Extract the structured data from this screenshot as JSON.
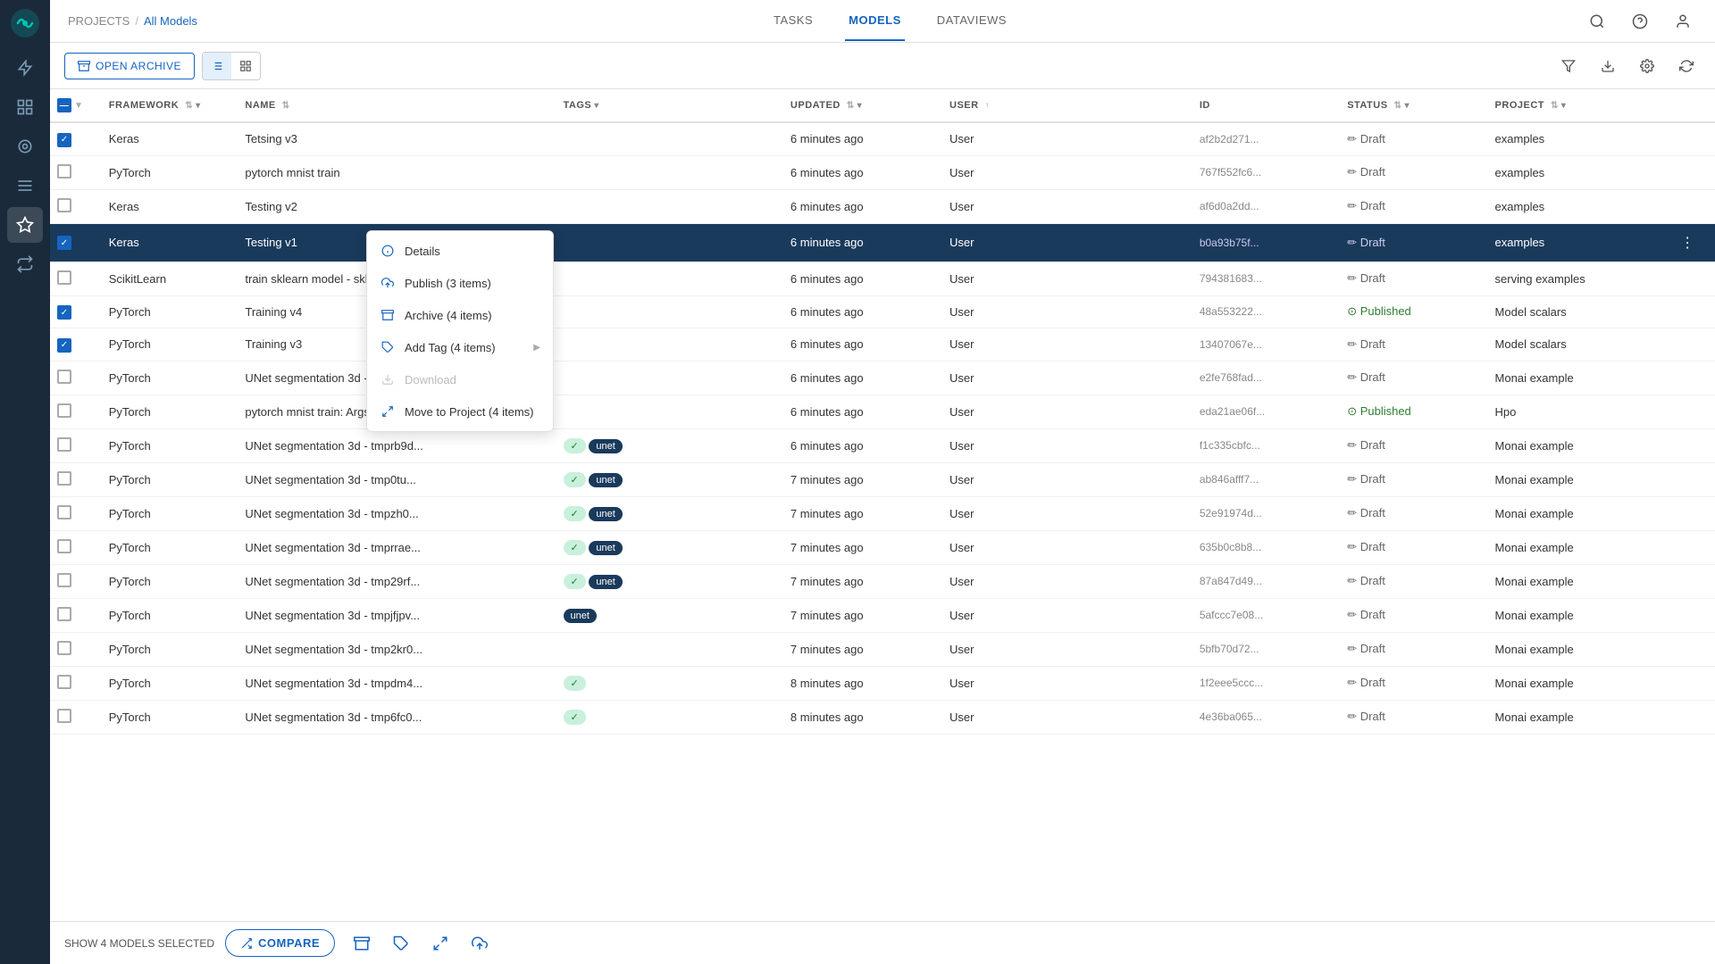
{
  "app": {
    "title": "ClearML"
  },
  "breadcrumb": {
    "parent": "PROJECTS",
    "separator": "/",
    "current": "All Models"
  },
  "nav": {
    "tabs": [
      {
        "id": "tasks",
        "label": "TASKS",
        "active": false
      },
      {
        "id": "models",
        "label": "MODELS",
        "active": true
      },
      {
        "id": "dataviews",
        "label": "DATAVIEWS",
        "active": false
      }
    ]
  },
  "toolbar": {
    "open_archive_label": "OPEN ARCHIVE"
  },
  "table": {
    "columns": [
      {
        "id": "check",
        "label": ""
      },
      {
        "id": "framework",
        "label": "FRAMEWORK"
      },
      {
        "id": "name",
        "label": "NAME"
      },
      {
        "id": "tags",
        "label": "TAGS"
      },
      {
        "id": "updated",
        "label": "UPDATED"
      },
      {
        "id": "user",
        "label": "USER"
      },
      {
        "id": "id",
        "label": "ID"
      },
      {
        "id": "status",
        "label": "STATUS"
      },
      {
        "id": "project",
        "label": "PROJECT"
      }
    ],
    "rows": [
      {
        "checked": true,
        "framework": "Keras",
        "name": "Tetsing v3",
        "tags": [],
        "updated": "6 minutes ago",
        "user": "User",
        "id": "af2b2d271...",
        "status": "Draft",
        "status_type": "draft",
        "project": "examples",
        "selected": false
      },
      {
        "checked": false,
        "framework": "PyTorch",
        "name": "pytorch mnist train",
        "tags": [],
        "updated": "6 minutes ago",
        "user": "User",
        "id": "767f552fc6...",
        "status": "Draft",
        "status_type": "draft",
        "project": "examples",
        "selected": false
      },
      {
        "checked": false,
        "framework": "Keras",
        "name": "Testing v2",
        "tags": [],
        "updated": "6 minutes ago",
        "user": "User",
        "id": "af6d0a2dd...",
        "status": "Draft",
        "status_type": "draft",
        "project": "examples",
        "selected": false
      },
      {
        "checked": true,
        "framework": "Keras",
        "name": "Testing v1",
        "tags": [],
        "updated": "6 minutes ago",
        "user": "User",
        "id": "b0a93b75f...",
        "status": "Draft",
        "status_type": "draft",
        "project": "examples",
        "selected": true
      },
      {
        "checked": false,
        "framework": "ScikitLearn",
        "name": "train sklearn model - sklearn-mo...",
        "tags": [],
        "updated": "6 minutes ago",
        "user": "User",
        "id": "794381683...",
        "status": "Draft",
        "status_type": "draft",
        "project": "serving examples",
        "selected": false
      },
      {
        "checked": true,
        "framework": "PyTorch",
        "name": "Training v4",
        "tags": [],
        "updated": "6 minutes ago",
        "user": "User",
        "id": "48a553222...",
        "status": "Published",
        "status_type": "published",
        "project": "Model scalars",
        "selected": false
      },
      {
        "checked": true,
        "framework": "PyTorch",
        "name": "Training v3",
        "tags": [],
        "updated": "6 minutes ago",
        "user": "User",
        "id": "13407067e...",
        "status": "Draft",
        "status_type": "draft",
        "project": "Model scalars",
        "selected": false
      },
      {
        "checked": false,
        "framework": "PyTorch",
        "name": "UNet segmentation 3d - tmpvjhyl...",
        "tags": [],
        "updated": "6 minutes ago",
        "user": "User",
        "id": "e2fe768fad...",
        "status": "Draft",
        "status_type": "draft",
        "project": "Monai example",
        "selected": false
      },
      {
        "checked": false,
        "framework": "PyTorch",
        "name": "pytorch mnist train: Args/lr=0.01",
        "tags": [],
        "updated": "6 minutes ago",
        "user": "User",
        "id": "eda21ae06f...",
        "status": "Published",
        "status_type": "published",
        "project": "Hpo",
        "selected": false
      },
      {
        "checked": false,
        "framework": "PyTorch",
        "name": "UNet segmentation 3d - tmprb9d...",
        "tags": [
          "✓",
          "unet"
        ],
        "updated": "6 minutes ago",
        "user": "User",
        "id": "f1c335cbfc...",
        "status": "Draft",
        "status_type": "draft",
        "project": "Monai example",
        "selected": false
      },
      {
        "checked": false,
        "framework": "PyTorch",
        "name": "UNet segmentation 3d - tmp0tu...",
        "tags": [
          "✓",
          "unet"
        ],
        "updated": "7 minutes ago",
        "user": "User",
        "id": "ab846afff7...",
        "status": "Draft",
        "status_type": "draft",
        "project": "Monai example",
        "selected": false
      },
      {
        "checked": false,
        "framework": "PyTorch",
        "name": "UNet segmentation 3d - tmpzh0...",
        "tags": [
          "✓",
          "unet"
        ],
        "updated": "7 minutes ago",
        "user": "User",
        "id": "52e91974d...",
        "status": "Draft",
        "status_type": "draft",
        "project": "Monai example",
        "selected": false
      },
      {
        "checked": false,
        "framework": "PyTorch",
        "name": "UNet segmentation 3d - tmprrae...",
        "tags": [
          "✓",
          "unet"
        ],
        "updated": "7 minutes ago",
        "user": "User",
        "id": "635b0c8b8...",
        "status": "Draft",
        "status_type": "draft",
        "project": "Monai example",
        "selected": false
      },
      {
        "checked": false,
        "framework": "PyTorch",
        "name": "UNet segmentation 3d - tmp29rf...",
        "tags": [
          "✓",
          "unet"
        ],
        "updated": "7 minutes ago",
        "user": "User",
        "id": "87a847d49...",
        "status": "Draft",
        "status_type": "draft",
        "project": "Monai example",
        "selected": false
      },
      {
        "checked": false,
        "framework": "PyTorch",
        "name": "UNet segmentation 3d - tmpjfjpv...",
        "tags": [
          "unet"
        ],
        "updated": "7 minutes ago",
        "user": "User",
        "id": "5afccc7e08...",
        "status": "Draft",
        "status_type": "draft",
        "project": "Monai example",
        "selected": false
      },
      {
        "checked": false,
        "framework": "PyTorch",
        "name": "UNet segmentation 3d - tmp2kr0...",
        "tags": [],
        "updated": "7 minutes ago",
        "user": "User",
        "id": "5bfb70d72...",
        "status": "Draft",
        "status_type": "draft",
        "project": "Monai example",
        "selected": false
      },
      {
        "checked": false,
        "framework": "PyTorch",
        "name": "UNet segmentation 3d - tmpdm4...",
        "tags": [
          "✓"
        ],
        "updated": "8 minutes ago",
        "user": "User",
        "id": "1f2eee5ccc...",
        "status": "Draft",
        "status_type": "draft",
        "project": "Monai example",
        "selected": false
      },
      {
        "checked": false,
        "framework": "PyTorch",
        "name": "UNet segmentation 3d - tmp6fc0...",
        "tags": [
          "✓"
        ],
        "updated": "8 minutes ago",
        "user": "User",
        "id": "4e36ba065...",
        "status": "Draft",
        "status_type": "draft",
        "project": "Monai example",
        "selected": false
      }
    ]
  },
  "context_menu": {
    "items": [
      {
        "id": "details",
        "label": "Details",
        "icon": "info",
        "disabled": false
      },
      {
        "id": "publish",
        "label": "Publish (3 items)",
        "icon": "upload",
        "disabled": false
      },
      {
        "id": "archive",
        "label": "Archive (4 items)",
        "icon": "archive",
        "disabled": false
      },
      {
        "id": "add-tag",
        "label": "Add Tag (4 items)",
        "icon": "tag",
        "disabled": false,
        "has_sub": true
      },
      {
        "id": "download",
        "label": "Download",
        "icon": "download",
        "disabled": true
      },
      {
        "id": "move-project",
        "label": "Move to Project (4 items)",
        "icon": "move",
        "disabled": false
      }
    ]
  },
  "bottom_bar": {
    "selected_label": "SHOW 4 MODELS SELECTED",
    "compare_label": "COMPARE"
  },
  "sidebar": {
    "items": [
      {
        "id": "home",
        "icon": "⚡",
        "active": false
      },
      {
        "id": "tasks",
        "icon": "▦",
        "active": false
      },
      {
        "id": "models",
        "icon": "◉",
        "active": false
      },
      {
        "id": "datasets",
        "icon": "≡",
        "active": false
      },
      {
        "id": "ml",
        "icon": "✦",
        "active": true
      },
      {
        "id": "pipelines",
        "icon": "⟳",
        "active": false
      }
    ]
  }
}
